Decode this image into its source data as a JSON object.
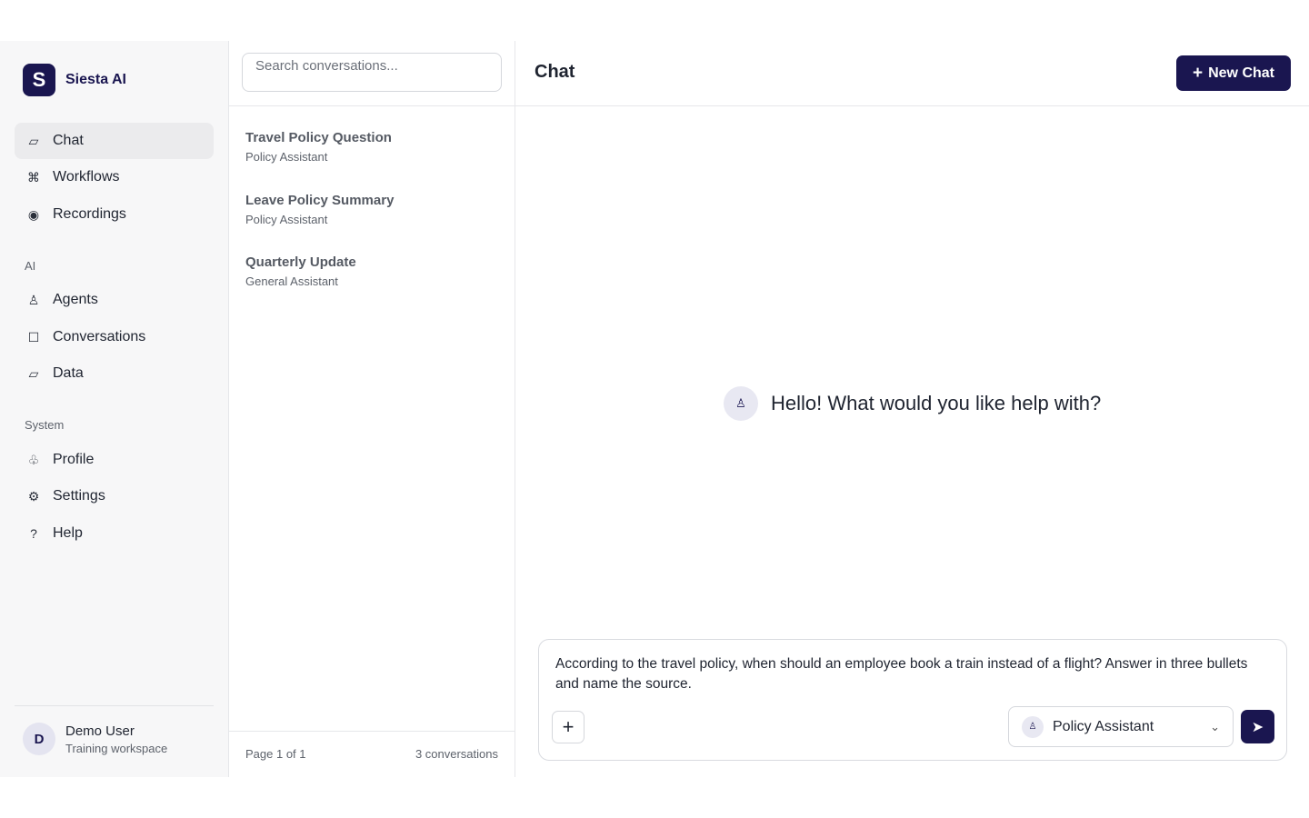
{
  "brand": {
    "logo_letter": "S",
    "name": "Siesta AI"
  },
  "nav": {
    "main": [
      {
        "label": "Chat",
        "icon": "chat-icon",
        "glyph": "▱",
        "active": true
      },
      {
        "label": "Workflows",
        "icon": "command-icon",
        "glyph": "⌘"
      },
      {
        "label": "Recordings",
        "icon": "record-icon",
        "glyph": "◉"
      }
    ],
    "ai_label": "AI",
    "ai": [
      {
        "label": "Agents",
        "icon": "agent-icon",
        "glyph": "♙"
      },
      {
        "label": "Conversations",
        "icon": "square-icon",
        "glyph": "☐"
      },
      {
        "label": "Data",
        "icon": "data-icon",
        "glyph": "▱"
      }
    ],
    "system_label": "System",
    "system": [
      {
        "label": "Profile",
        "icon": "profile-icon",
        "glyph": "♧"
      },
      {
        "label": "Settings",
        "icon": "gear-icon",
        "glyph": "⚙"
      },
      {
        "label": "Help",
        "icon": "help-icon",
        "glyph": "?"
      }
    ]
  },
  "user": {
    "initial": "D",
    "name": "Demo User",
    "workspace": "Training workspace"
  },
  "conversations": {
    "search_placeholder": "Search conversations...",
    "items": [
      {
        "title": "Travel Policy Question",
        "agent": "Policy Assistant"
      },
      {
        "title": "Leave Policy Summary",
        "agent": "Policy Assistant"
      },
      {
        "title": "Quarterly Update",
        "agent": "General Assistant"
      }
    ],
    "page_info": "Page 1 of 1",
    "count": "3 conversations"
  },
  "main": {
    "title": "Chat",
    "new_chat_label": "New Chat",
    "new_chat_glyph": "+",
    "greeting": "Hello! What would you like help with?",
    "agent_glyph": "♙"
  },
  "composer": {
    "text": "According to the travel policy, when should an employee book a train instead of a flight? Answer in three bullets and name the source.",
    "attach_glyph": "+",
    "selected_agent": "Policy Assistant",
    "agent_glyph": "♙",
    "chevron_glyph": "⌄",
    "send_glyph": "➤"
  },
  "colors": {
    "accent": "#1a1650",
    "sidebar_bg": "#f7f7f8",
    "active_bg": "#ebebed"
  }
}
